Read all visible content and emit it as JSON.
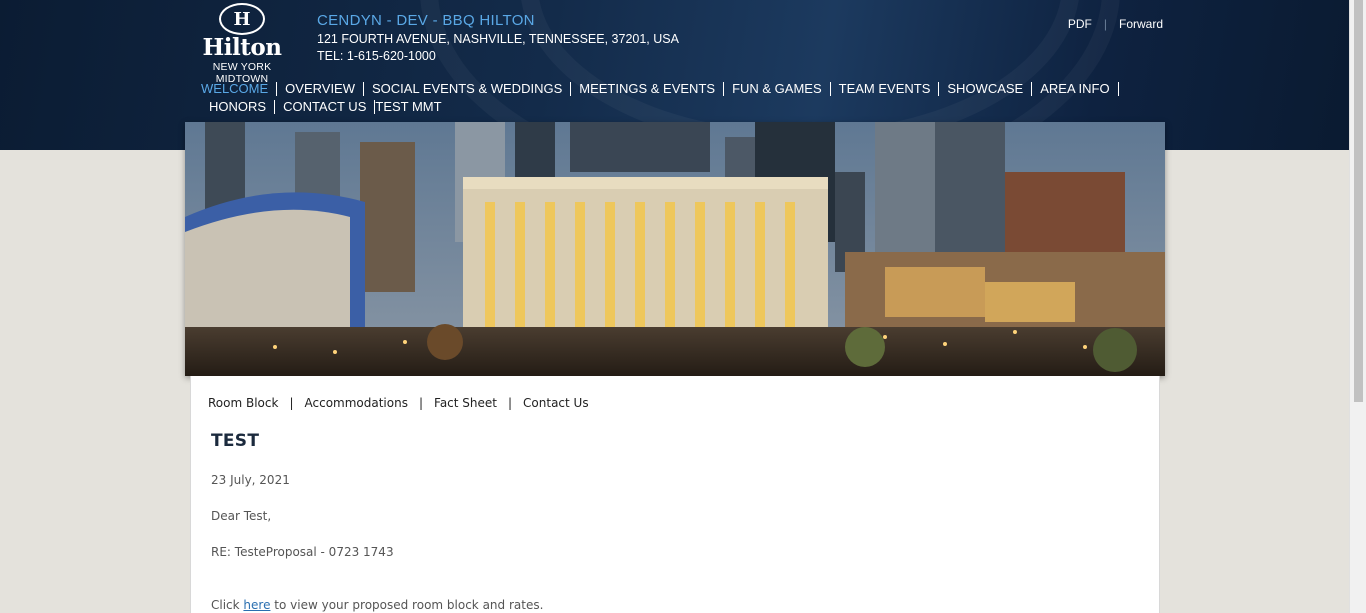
{
  "header": {
    "logo_mark": "H",
    "logo_word": "Hilton",
    "logo_sub": "NEW YORK MIDTOWN",
    "property_name": "CENDYN - DEV - BBQ HILTON",
    "address": "121 FOURTH AVENUE, NASHVILLE, TENNESSEE, 37201, USA",
    "tel": "TEL: 1-615-620-1000",
    "links": {
      "pdf": "PDF",
      "separator": "|",
      "forward": "Forward"
    }
  },
  "nav": {
    "items": [
      {
        "label": "WELCOME",
        "active": true
      },
      {
        "label": "OVERVIEW"
      },
      {
        "label": "SOCIAL EVENTS & WEDDINGS"
      },
      {
        "label": "MEETINGS & EVENTS"
      },
      {
        "label": "FUN & GAMES"
      },
      {
        "label": "TEAM EVENTS"
      },
      {
        "label": "SHOWCASE"
      },
      {
        "label": "AREA INFO"
      },
      {
        "label": "HONORS"
      },
      {
        "label": "CONTACT US"
      },
      {
        "label": "TEST MMT"
      }
    ]
  },
  "subnav": {
    "items": [
      "Room Block",
      "Accommodations",
      "Fact Sheet",
      "Contact Us"
    ],
    "separator": "|"
  },
  "content": {
    "title": "TEST",
    "date": "23 July, 2021",
    "greeting": "Dear Test,",
    "re": "RE: TesteProposal - 0723 1743",
    "click_prefix": "Click",
    "click_link": "here",
    "click_suffix": "to view your proposed room block and rates."
  },
  "colors": {
    "header_bg": "#0f2440",
    "accent_blue": "#5aa8e6",
    "page_bg": "#e4e2dc",
    "link": "#2a6fb0"
  }
}
